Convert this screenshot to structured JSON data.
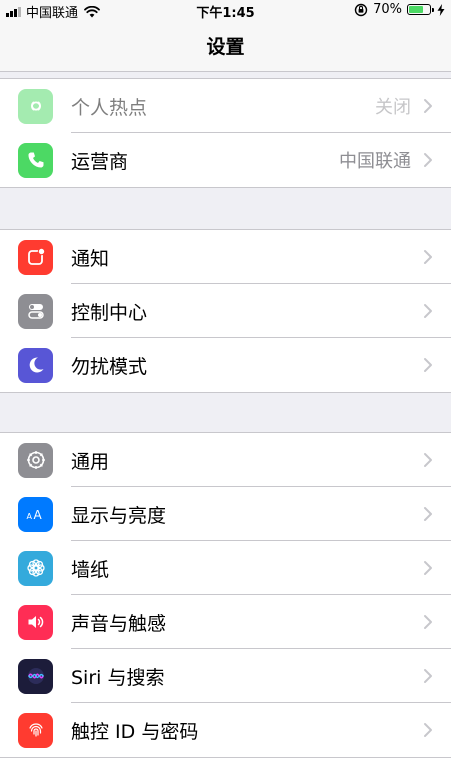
{
  "status_bar": {
    "carrier": "中国联通",
    "time": "下午1:45",
    "battery_percent": "70%",
    "battery_level": 0.7
  },
  "nav": {
    "title": "设置"
  },
  "groups": [
    {
      "items": [
        {
          "label": "个人热点",
          "value": "关闭",
          "icon": "hotspot-icon",
          "color": "#4cd964",
          "enabled": false
        },
        {
          "label": "运营商",
          "value": "中国联通",
          "icon": "phone-icon",
          "color": "#4cd964",
          "enabled": true
        }
      ]
    },
    {
      "items": [
        {
          "label": "通知",
          "icon": "notifications-icon",
          "color": "#ff3b30"
        },
        {
          "label": "控制中心",
          "icon": "control-center-icon",
          "color": "#8e8e93"
        },
        {
          "label": "勿扰模式",
          "icon": "moon-icon",
          "color": "#5856d6"
        }
      ]
    },
    {
      "items": [
        {
          "label": "通用",
          "icon": "gear-icon",
          "color": "#8e8e93"
        },
        {
          "label": "显示与亮度",
          "icon": "display-icon",
          "color": "#007aff"
        },
        {
          "label": "墙纸",
          "icon": "wallpaper-icon",
          "color": "#34aadc"
        },
        {
          "label": "声音与触感",
          "icon": "sound-icon",
          "color": "#ff2d55"
        },
        {
          "label": "Siri 与搜索",
          "icon": "siri-icon",
          "color": "#1c1c3a"
        },
        {
          "label": "触控 ID 与密码",
          "icon": "fingerprint-icon",
          "color": "#ff3b30"
        }
      ]
    }
  ]
}
